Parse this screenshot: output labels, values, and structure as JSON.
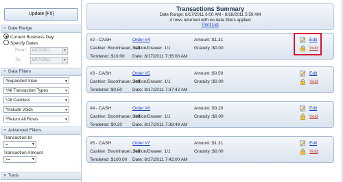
{
  "left_panel": {
    "update_label": "Update [F5]",
    "date_range": {
      "header": "Date Range",
      "option_current": "Current Business Day",
      "option_specify": "Specify Dates",
      "from_label": "From:",
      "from_value": "8/10/2011",
      "to_label": "To:",
      "to_value": "8/17/2011"
    },
    "data_filters": {
      "header": "Data Filters",
      "selects": [
        "*Expanded View",
        "*All Transaction Types",
        "*All Cashiers",
        "*Include Voids",
        "*Return All Rows"
      ]
    },
    "advanced_filters": {
      "header": "Advanced Filters",
      "transaction_id_label": "Transaction Id",
      "transaction_id_op": "=",
      "transaction_amount_label": "Transaction Amount",
      "transaction_amount_op": ">="
    },
    "tools_header": "Tools"
  },
  "summary": {
    "title": "Transactions Summary",
    "date_range": "Date Range: 8/17/2011 6:00 AM - 8/18/2011 5:59 AM",
    "rows_info": "4 rows returned with no data filters applied",
    "print_link": "Print List"
  },
  "transactions": [
    {
      "type": "#2 - CASH",
      "order": "Order #4",
      "amount": "Amount :$1.31",
      "cashier": "Cashier: Boomhauer, Jeff",
      "station": "Station/Drawer: 1/1",
      "gratuity": "Gratuity :$0.00",
      "tendered": "Tendered :$10.00",
      "date": "Date: 8/17/2011 7:35:00 AM",
      "edit": "Edit",
      "void": "Void"
    },
    {
      "type": "#3 - CASH",
      "order": "Order #5",
      "amount": "Amount :$0.50",
      "cashier": "Cashier: Boomhauer, Jeff",
      "station": "Station/Drawer: 1/1",
      "gratuity": "Gratuity :$0.00",
      "tendered": "Tendered :$0.50",
      "date": "Date: 8/17/2011 7:37:42 AM",
      "edit": "Edit",
      "void": "Void"
    },
    {
      "type": "#4 - CASH",
      "order": "Order #6",
      "amount": "Amount :$0.20",
      "cashier": "Cashier: Boomhauer, Jeff",
      "station": "Station/Drawer: 1/1",
      "gratuity": "Gratuity :$0.00",
      "tendered": "Tendered :$0.20",
      "date": "Date: 8/17/2011 7:38:48 AM",
      "edit": "Edit",
      "void": "Void"
    },
    {
      "type": "#5 - CASH",
      "order": "Order #7",
      "amount": "Amount :$1.31",
      "cashier": "Cashier: Boomhauer, Jeff",
      "station": "Station/Drawer: 1/1",
      "gratuity": "Gratuity :$0.00",
      "tendered": "Tendered :$100.00",
      "date": "Date: 8/17/2011 7:42:00 AM",
      "edit": "Edit",
      "void": "Void"
    }
  ],
  "icons": {
    "edit": "edit-pencil-icon",
    "void": "padlock-icon",
    "expand": "plus-icon",
    "collapse": "minus-icon"
  },
  "colors": {
    "link": "#1a3fc1",
    "void_link": "#c0392b",
    "highlight": "#d8102a",
    "card_bg": "#dbe4ef"
  }
}
